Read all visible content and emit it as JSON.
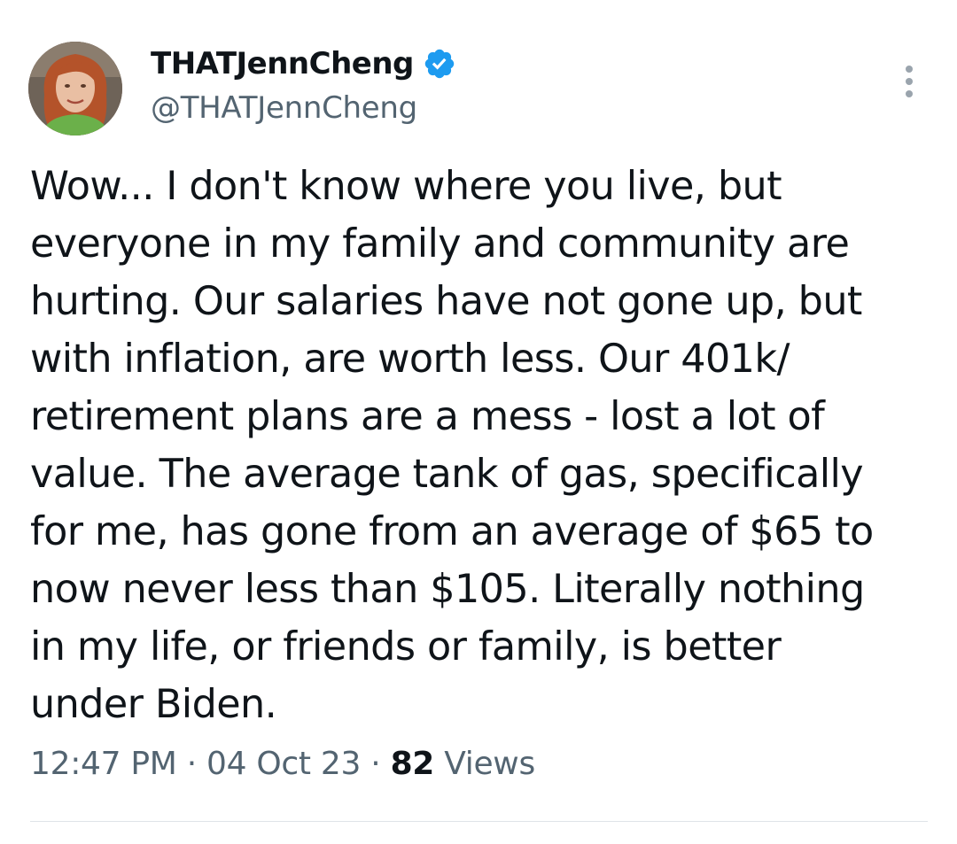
{
  "author": {
    "display_name": "THATJennCheng",
    "handle": "@THATJennCheng",
    "verified": true,
    "verified_icon": "verified-badge-icon"
  },
  "tweet": {
    "text": "Wow... I don't know where you live, but\neveryone in my family and community are\nhurting. Our salaries have not gone up, but\nwith inflation, are worth less. Our 401k/\nretirement plans are a mess - lost a lot of\nvalue. The average tank of gas, specifically\nfor me, has gone from an average of $65 to\nnow never less than $105.  Literally nothing\nin my life, or friends or family, is better\nunder Biden."
  },
  "meta": {
    "time": "12:47 PM",
    "date": "04 Oct 23",
    "views_count": "82",
    "views_label": "Views",
    "separator": "·"
  },
  "colors": {
    "text_primary": "#0f1419",
    "text_secondary": "#536471",
    "verified_blue": "#1d9bf0",
    "divider": "#dfe4e8"
  },
  "icons": {
    "more": "more-options-icon"
  }
}
